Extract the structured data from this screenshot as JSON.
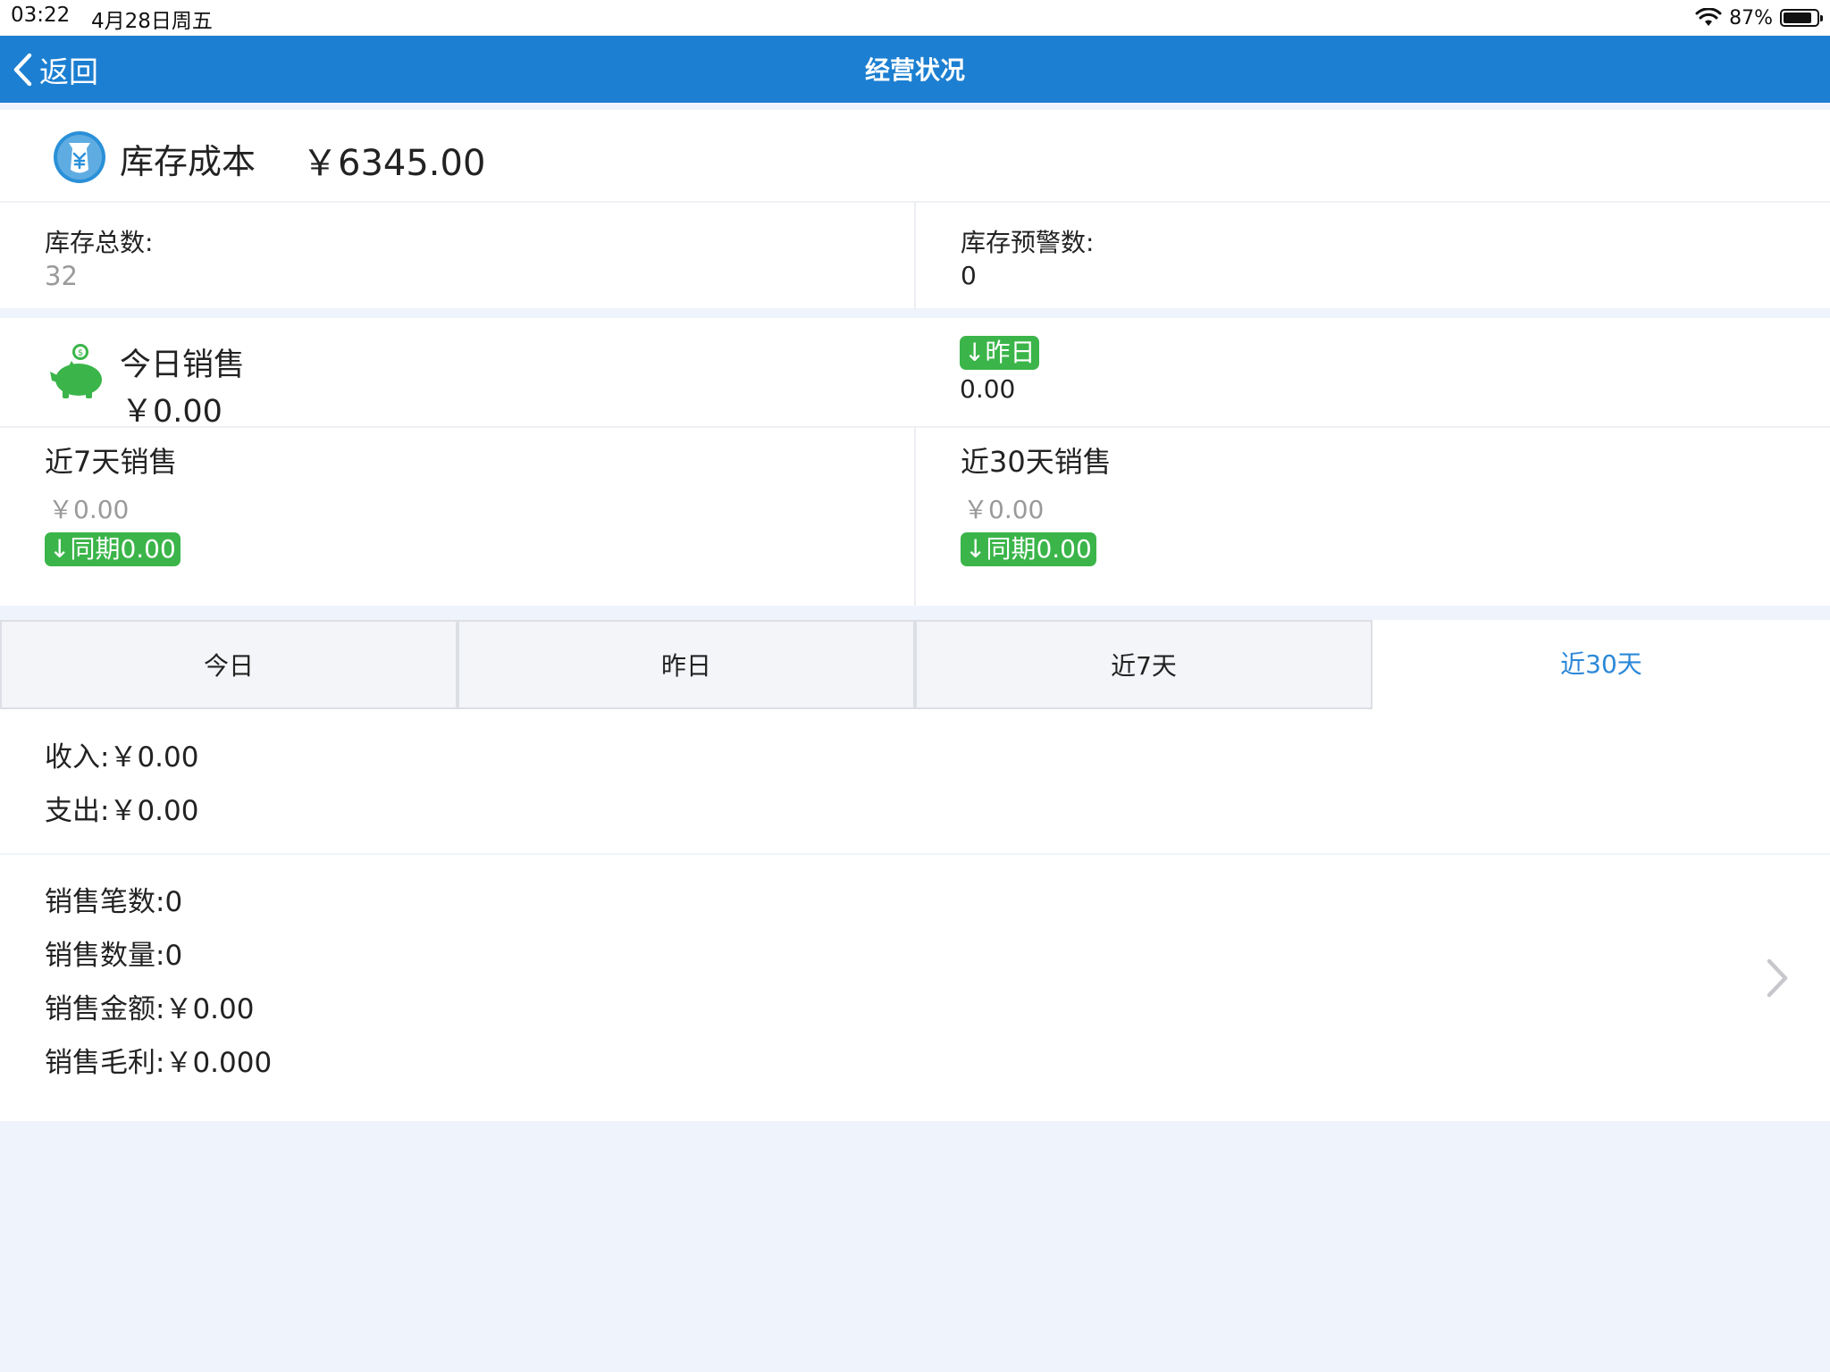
{
  "status_bar": {
    "time": "03:22",
    "date": "4月28日周五",
    "battery_text": "87%",
    "battery_level": 0.87
  },
  "nav": {
    "back_label": "返回",
    "title": "经营状况"
  },
  "inventory": {
    "cost_label": "库存成本",
    "cost_value": "￥6345.00",
    "total_label": "库存总数:",
    "total_value": "32",
    "warning_label": "库存预警数:",
    "warning_value": "0"
  },
  "sales": {
    "today_label": "今日销售",
    "today_value": "￥0.00",
    "yesterday_badge": "↓昨日",
    "yesterday_value": "0.00",
    "week_label": "近7天销售",
    "week_value": "￥0.00",
    "week_badge": "↓同期0.00",
    "month_label": "近30天销售",
    "month_value": "￥0.00",
    "month_badge": "↓同期0.00"
  },
  "tabs": [
    {
      "label": "今日",
      "active": false
    },
    {
      "label": "昨日",
      "active": false
    },
    {
      "label": "近7天",
      "active": false
    },
    {
      "label": "近30天",
      "active": true
    }
  ],
  "finance": {
    "income": "收入:￥0.00",
    "expense": "支出:￥0.00"
  },
  "sales_detail": {
    "count": "销售笔数:0",
    "quantity": "销售数量:0",
    "amount": "销售金额:￥0.00",
    "gross_profit": "销售毛利:￥0.000"
  },
  "colors": {
    "nav_blue": "#1c7fd1",
    "badge_green": "#3bb54a",
    "active_tab": "#2b88d8",
    "page_bg": "#eff4fc"
  },
  "icons": {
    "back": "chevron-left-icon",
    "inventory": "money-bag-icon",
    "sales": "piggy-bank-icon",
    "detail": "chevron-right-icon",
    "wifi": "wifi-icon",
    "battery": "battery-icon"
  }
}
